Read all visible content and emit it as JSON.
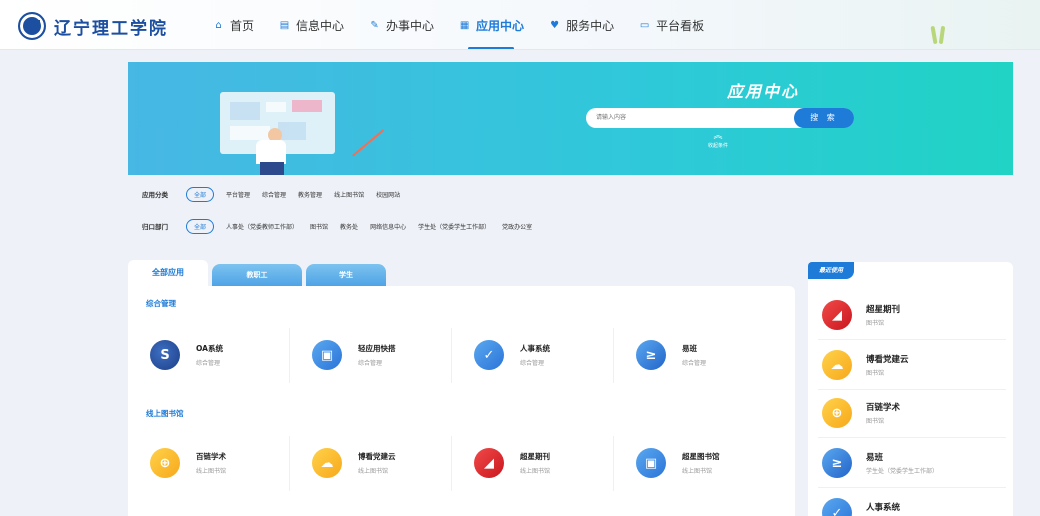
{
  "header": {
    "logo_text": "辽宁理工学院",
    "nav": [
      {
        "label": "首页",
        "icon": "home-icon",
        "glyph": "⌂"
      },
      {
        "label": "信息中心",
        "icon": "info-icon",
        "glyph": "▤"
      },
      {
        "label": "办事中心",
        "icon": "task-icon",
        "glyph": "✎"
      },
      {
        "label": "应用中心",
        "icon": "apps-icon",
        "glyph": "▦",
        "active": true
      },
      {
        "label": "服务中心",
        "icon": "service-icon",
        "glyph": "♥"
      },
      {
        "label": "平台看板",
        "icon": "dashboard-icon",
        "glyph": "▭"
      }
    ]
  },
  "banner": {
    "title": "应用中心",
    "search_placeholder": "请输入内容",
    "search_button": "搜 索",
    "collapse_label": "收起条件"
  },
  "filters": {
    "category_label": "应用分类",
    "category_options": [
      "全部",
      "平台管理",
      "综合管理",
      "教务管理",
      "线上图书馆",
      "校园网站"
    ],
    "dept_label": "归口部门",
    "dept_options": [
      "全部",
      "人事处（党委教师工作部）",
      "图书馆",
      "教务处",
      "网络信息中心",
      "学生处（党委学生工作部）",
      "党政办公室"
    ]
  },
  "tabs": [
    "全部应用",
    "教职工",
    "学生"
  ],
  "sections": [
    {
      "title": "综合管理",
      "apps": [
        {
          "name": "OA系统",
          "category": "综合管理",
          "icon": "oa-icon"
        },
        {
          "name": "轻应用快搭",
          "category": "综合管理",
          "icon": "image-icon"
        },
        {
          "name": "人事系统",
          "category": "综合管理",
          "icon": "check-shield-icon"
        },
        {
          "name": "易班",
          "category": "综合管理",
          "icon": "yiban-icon"
        }
      ]
    },
    {
      "title": "线上图书馆",
      "apps": [
        {
          "name": "百链学术",
          "category": "线上图书馆",
          "icon": "search-book-icon"
        },
        {
          "name": "博看党建云",
          "category": "线上图书馆",
          "icon": "cloud-icon"
        },
        {
          "name": "超星期刊",
          "category": "线上图书馆",
          "icon": "journal-icon"
        },
        {
          "name": "超星图书馆",
          "category": "线上图书馆",
          "icon": "image-icon"
        }
      ]
    }
  ],
  "recent": {
    "label": "最近使用",
    "items": [
      {
        "name": "超星期刊",
        "category": "图书馆",
        "icon": "journal-icon"
      },
      {
        "name": "博看党建云",
        "category": "图书馆",
        "icon": "cloud-icon"
      },
      {
        "name": "百链学术",
        "category": "图书馆",
        "icon": "search-book-icon"
      },
      {
        "name": "易班",
        "category": "学生处（党委学生工作部）",
        "icon": "yiban-icon"
      },
      {
        "name": "人事系统",
        "category": "",
        "icon": "check-shield-icon"
      }
    ]
  },
  "colors": {
    "primary": "#1e7bd8",
    "banner_start": "#47b7e4",
    "banner_end": "#20d3c4"
  }
}
